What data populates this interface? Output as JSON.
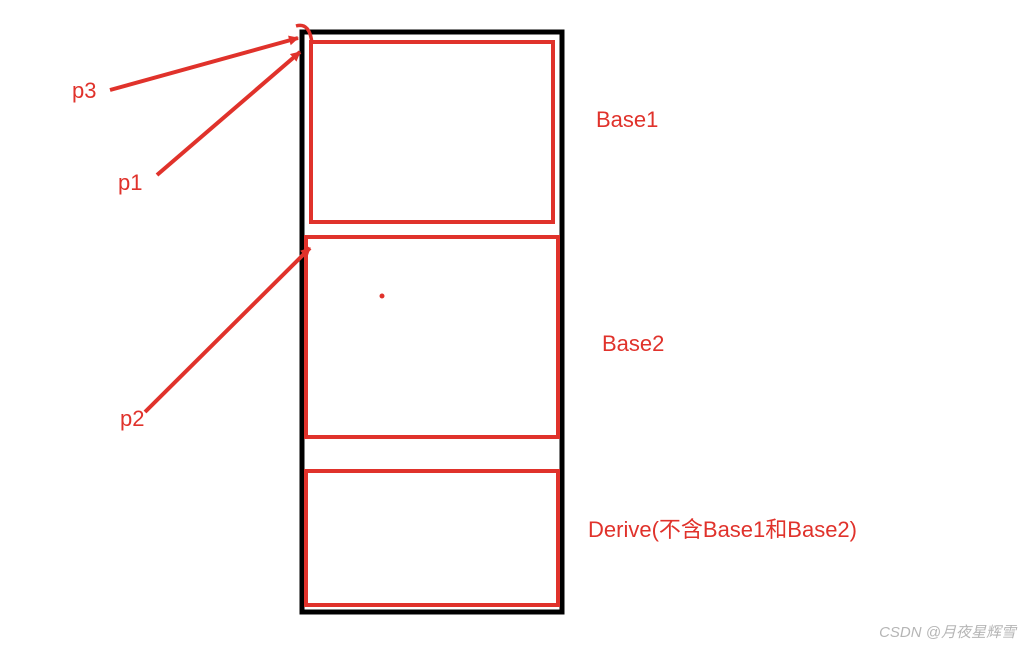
{
  "pointers": {
    "p3": "p3",
    "p1": "p1",
    "p2": "p2"
  },
  "blocks": {
    "base1": "Base1",
    "base2": "Base2",
    "derive": "Derive(不含Base1和Base2)"
  },
  "watermark": "CSDN @月夜星辉雪",
  "colors": {
    "red": "#e0322b",
    "black": "#000000"
  }
}
